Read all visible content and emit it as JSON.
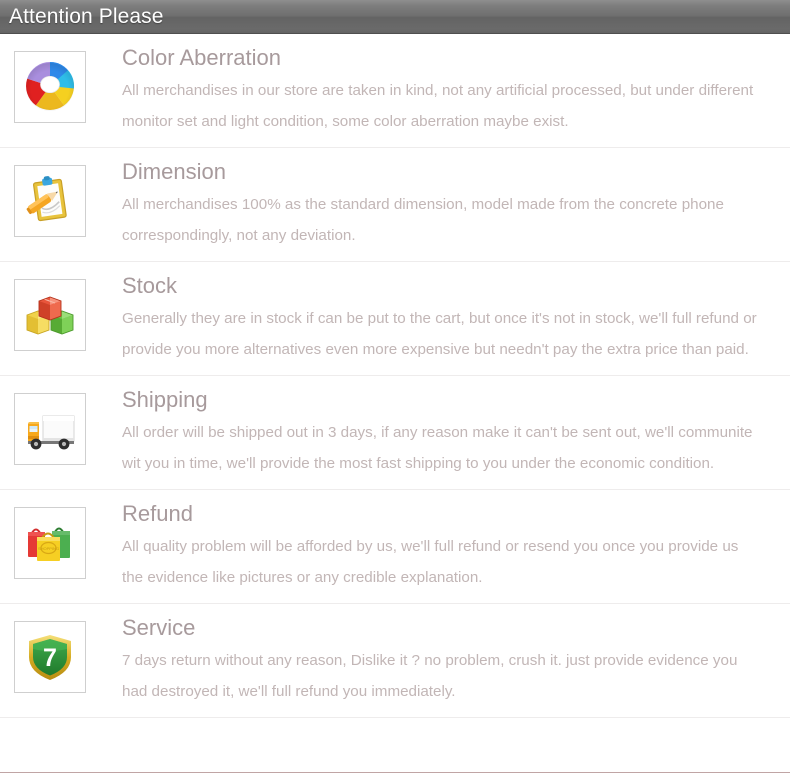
{
  "header": {
    "title": "Attention Please"
  },
  "colors": {
    "header_gradient_top": "#8e8e8e",
    "header_gradient_bottom": "#636363",
    "header_text": "#ffffff",
    "row_title": "#a79a9c",
    "row_body": "#c2b6b6",
    "divider": "#eceaea",
    "icon_frame_border": "#cfcfcf",
    "page_background": "#ffffff"
  },
  "sections": [
    {
      "icon": "color-wheel-icon",
      "title": "Color Aberration",
      "lines": [
        "All merchandises in our store are taken in kind, not any artificial processed, but under different",
        "monitor set and light condition, some color aberration maybe exist."
      ]
    },
    {
      "icon": "clipboard-pencil-icon",
      "title": "Dimension",
      "lines": [
        "All merchandises 100% as the standard dimension, model made from the concrete phone",
        "correspondingly, not any deviation."
      ]
    },
    {
      "icon": "boxes-icon",
      "title": "Stock",
      "lines": [
        "Generally they are in stock if can be put to the cart, but once it's not in stock, we'll full refund or",
        "provide you more alternatives even more expensive but needn't pay the extra price than paid."
      ]
    },
    {
      "icon": "delivery-truck-icon",
      "title": "Shipping",
      "lines": [
        "All order will be shipped out in 3 days, if any reason make it can't be sent out, we'll communite",
        "wit you in time, we'll provide the most fast shipping to you under the economic condition."
      ]
    },
    {
      "icon": "shopping-bags-icon",
      "title": "Refund",
      "lines": [
        "All quality problem will be afforded by us, we'll full refund or resend you once you provide us",
        "the evidence like pictures or any credible explanation."
      ]
    },
    {
      "icon": "shield-seven-icon",
      "title": "Service",
      "lines": [
        "7 days return without any reason, Dislike it ? no problem, crush it. just provide evidence you",
        "had destroyed it, we'll full refund you immediately."
      ]
    }
  ]
}
